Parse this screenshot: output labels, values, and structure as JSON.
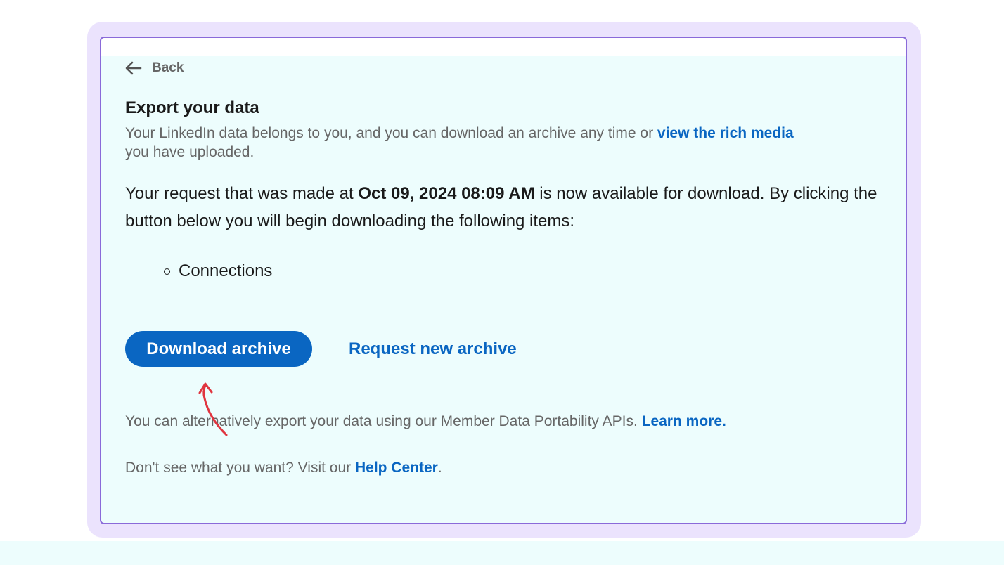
{
  "header": {
    "back_label": "Back"
  },
  "page": {
    "title": "Export your data",
    "intro_text": "Your LinkedIn data belongs to you, and you can download an archive any time or ",
    "intro_link": "view the rich media",
    "intro_suffix": "you have uploaded."
  },
  "request": {
    "prefix": "Your request that was made at ",
    "timestamp": "Oct 09, 2024 08:09 AM",
    "suffix": " is now available for download. By clicking the button below you will begin downloading the following items:"
  },
  "items": [
    "Connections"
  ],
  "actions": {
    "download_label": "Download archive",
    "request_new_label": "Request new archive"
  },
  "alt_export": {
    "text": "You can alternatively export your data using our Member Data Portability APIs. ",
    "link": "Learn more."
  },
  "help": {
    "text": "Don't see what you want? Visit our ",
    "link": "Help Center",
    "suffix": "."
  },
  "colors": {
    "brand_blue": "#0a66c2",
    "card_background": "#edfdfd",
    "frame_background": "#ebe3fd",
    "card_border": "#8a6ad9",
    "annotation_arrow": "#e0353f"
  },
  "icons": {
    "back": "arrow-left-icon",
    "list_bullet": "hollow-circle-bullet",
    "annotation": "red-curved-arrow-icon"
  }
}
